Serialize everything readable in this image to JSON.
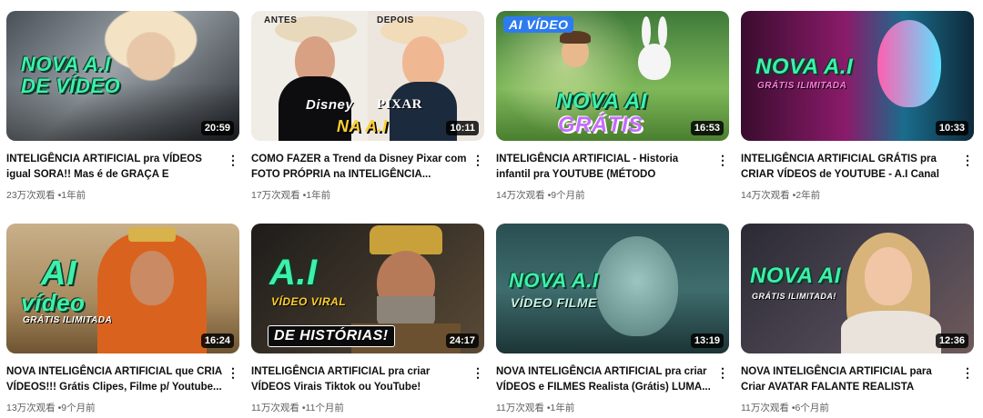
{
  "videos": [
    {
      "title": "INTELIGÊNCIA ARTIFICIAL pra VÍDEOS igual SORA!! Mas é de GRAÇA E ILIMITADA",
      "duration": "20:59",
      "views": "23万次观看",
      "age": "1年前",
      "overlay": [
        "NOVA A.I",
        "DE VÍDEO"
      ]
    },
    {
      "title": "COMO FAZER a Trend da Disney Pixar com FOTO PRÓPRIA na INTELIGÊNCIA...",
      "duration": "10:11",
      "views": "17万次观看",
      "age": "1年前",
      "overlay": [
        "ANTES",
        "DEPOIS",
        "Disney",
        "PIXAR",
        "NA A.I"
      ]
    },
    {
      "title": "INTELIGÊNCIA ARTIFICIAL - Historia infantil pra YOUTUBE (MÉTODO DESATUALIZADO-...",
      "duration": "16:53",
      "views": "14万次观看",
      "age": "9个月前",
      "overlay": [
        "AI VÍDEO",
        "NOVA AI",
        "GRÁTIS"
      ]
    },
    {
      "title": "INTELIGÊNCIA ARTIFICIAL GRÁTIS pra CRIAR VÍDEOS de YOUTUBE - A.I Canal Dark",
      "duration": "10:33",
      "views": "14万次观看",
      "age": "2年前",
      "overlay": [
        "NOVA A.I",
        "GRÁTIS ILIMITADA"
      ]
    },
    {
      "title": "NOVA INTELIGÊNCIA ARTIFICIAL que CRIA VÍDEOS!!! Grátis Clipes, Filme p/ Youtube...",
      "duration": "16:24",
      "views": "13万次观看",
      "age": "9个月前",
      "overlay": [
        "AI",
        "vídeo",
        "GRÁTIS ILIMITADA"
      ]
    },
    {
      "title": "INTELIGÊNCIA ARTIFICIAL pra criar VÍDEOS Virais Tiktok ou YouTube!",
      "duration": "24:17",
      "views": "11万次观看",
      "age": "11个月前",
      "overlay": [
        "A.I",
        "VÍDEO VIRAL",
        "DE HISTÓRIAS!"
      ]
    },
    {
      "title": "NOVA INTELIGÊNCIA ARTIFICIAL pra criar VÍDEOS e FILMES Realista (Grátis) LUMA...",
      "duration": "13:19",
      "views": "11万次观看",
      "age": "1年前",
      "overlay": [
        "NOVA A.I",
        "VÍDEO FILME"
      ]
    },
    {
      "title": "NOVA INTELIGÊNCIA ARTIFICIAL para Criar AVATAR FALANTE REALISTA (Youtube) [A...",
      "duration": "12:36",
      "views": "11万次观看",
      "age": "6个月前",
      "overlay": [
        "NOVA AI",
        "GRÁTIS ILIMITADA!"
      ]
    }
  ],
  "separator": "•",
  "more_glyph": "⋮"
}
